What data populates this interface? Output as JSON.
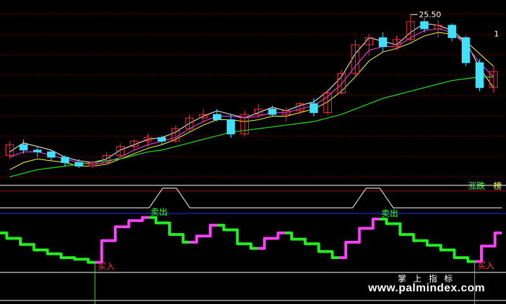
{
  "colors": {
    "background": "#000000",
    "up_candle": "#ff3030",
    "down_candle": "#40e0ff",
    "ma_short": "#ffffff",
    "ma_mid": "#ffff40",
    "ma_long": "#ff40ff",
    "ma_longest": "#20e020",
    "grid": "#7a1010",
    "osc_up": "#ff40ff",
    "osc_down": "#20f020",
    "osc_signal": "#ffffff",
    "osc_level_mid": "#2030ff",
    "buy_text": "#ff3030",
    "sell_text": "#30ff30"
  },
  "top_panel": {
    "high_label": "25.50",
    "ma_label": "1"
  },
  "tabs": {
    "tab1": "涨跌",
    "tab2": "榜"
  },
  "signals": {
    "buy": "买入",
    "sell": "卖出"
  },
  "watermark": {
    "line1": "掌上指标",
    "line2": "www.palmindex.com"
  },
  "chart_data": [
    {
      "type": "candlestick",
      "title": "",
      "series": [
        {
          "name": "",
          "values": [
            17.8,
            18.3,
            18.1,
            17.9,
            17.5,
            17.3,
            17.2,
            17.4,
            17.9,
            18.2,
            18.5,
            18.6,
            18.9,
            19.4,
            19.8,
            20.1,
            19.9,
            19.7,
            20.0,
            20.3,
            20.1,
            20.4,
            20.6,
            21.2,
            22.0,
            23.3,
            24.2,
            24.0,
            23.8,
            24.5,
            25.0,
            24.9,
            24.6,
            24.0,
            22.5,
            21.4
          ]
        },
        {
          "name": "",
          "values": [
            16.8,
            17.2,
            17.4,
            17.3,
            17.2,
            17.0,
            17.0,
            17.1,
            17.4,
            17.7,
            18.0,
            18.2,
            18.5,
            18.9,
            19.3,
            19.6,
            19.6,
            19.5,
            19.6,
            19.8,
            19.8,
            20.0,
            20.2,
            20.6,
            21.2,
            22.0,
            22.9,
            23.4,
            23.6,
            23.9,
            24.3,
            24.5,
            24.4,
            24.0,
            23.3,
            22.6
          ]
        },
        {
          "name": "",
          "values": [
            17.5,
            17.8,
            17.8,
            17.6,
            17.4,
            17.2,
            17.1,
            17.2,
            17.5,
            17.9,
            18.2,
            18.4,
            18.6,
            19.1,
            19.5,
            19.8,
            19.8,
            19.7,
            19.8,
            20.0,
            20.0,
            20.2,
            20.4,
            20.9,
            21.6,
            22.6,
            23.5,
            23.7,
            23.7,
            24.2,
            24.6,
            24.7,
            24.5,
            23.8,
            22.8,
            22.0
          ]
        },
        {
          "name": "",
          "values": [
            16.4,
            16.6,
            16.8,
            16.9,
            17.0,
            17.1,
            17.2,
            17.3,
            17.4,
            17.6,
            17.8,
            17.9,
            18.1,
            18.3,
            18.5,
            18.7,
            18.9,
            19.0,
            19.1,
            19.2,
            19.3,
            19.4,
            19.5,
            19.7,
            19.9,
            20.2,
            20.5,
            20.8,
            21.0,
            21.2,
            21.4,
            21.6,
            21.8,
            21.9,
            22.0,
            22.0
          ]
        }
      ],
      "ohlc": [
        [
          17.6,
          18.4,
          17.4,
          18.2
        ],
        [
          18.2,
          18.5,
          17.7,
          17.9
        ],
        [
          17.9,
          18.1,
          17.5,
          17.8
        ],
        [
          17.8,
          17.9,
          17.3,
          17.5
        ],
        [
          17.5,
          17.6,
          17.0,
          17.2
        ],
        [
          17.2,
          17.4,
          16.9,
          17.0
        ],
        [
          17.0,
          17.3,
          16.9,
          17.2
        ],
        [
          17.2,
          17.8,
          17.1,
          17.6
        ],
        [
          17.6,
          18.3,
          17.5,
          18.1
        ],
        [
          18.1,
          18.5,
          17.9,
          18.4
        ],
        [
          18.4,
          18.8,
          18.1,
          18.6
        ],
        [
          18.6,
          18.7,
          18.2,
          18.4
        ],
        [
          18.4,
          19.3,
          18.3,
          19.1
        ],
        [
          19.1,
          19.9,
          18.9,
          19.7
        ],
        [
          19.7,
          20.2,
          19.4,
          19.9
        ],
        [
          19.9,
          20.2,
          19.5,
          19.6
        ],
        [
          19.6,
          19.9,
          18.6,
          18.8
        ],
        [
          18.8,
          20.1,
          18.7,
          19.9
        ],
        [
          19.9,
          20.5,
          19.7,
          20.2
        ],
        [
          20.2,
          20.4,
          19.8,
          19.9
        ],
        [
          19.9,
          20.3,
          19.5,
          20.1
        ],
        [
          20.1,
          20.6,
          19.9,
          20.5
        ],
        [
          20.5,
          20.8,
          19.8,
          20.0
        ],
        [
          20.0,
          21.3,
          19.9,
          21.1
        ],
        [
          21.1,
          22.4,
          21.0,
          22.2
        ],
        [
          22.2,
          24.1,
          22.0,
          23.8
        ],
        [
          23.8,
          24.4,
          23.2,
          24.2
        ],
        [
          24.2,
          24.5,
          23.4,
          23.7
        ],
        [
          23.7,
          24.3,
          23.5,
          24.1
        ],
        [
          24.1,
          25.5,
          24.0,
          25.1
        ],
        [
          25.1,
          25.3,
          24.5,
          24.7
        ],
        [
          24.7,
          25.2,
          24.2,
          24.9
        ],
        [
          24.9,
          25.0,
          24.0,
          24.2
        ],
        [
          24.2,
          24.3,
          22.6,
          22.8
        ],
        [
          22.8,
          23.0,
          21.2,
          21.4
        ],
        [
          21.4,
          22.6,
          21.1,
          22.3
        ]
      ],
      "ylim": [
        16.0,
        26.0
      ]
    },
    {
      "type": "line",
      "title": "",
      "series": [
        {
          "name": "",
          "values": [
            62,
            55,
            47,
            40,
            35,
            30,
            28,
            24,
            52,
            70,
            78,
            82,
            75,
            60,
            50,
            58,
            72,
            66,
            48,
            42,
            55,
            62,
            54,
            48,
            38,
            30,
            50,
            68,
            80,
            74,
            60,
            52,
            46,
            40,
            30,
            25,
            45,
            62
          ]
        },
        {
          "name": "",
          "values": [
            0,
            0,
            0,
            0,
            0,
            0,
            0,
            0,
            0,
            0,
            0,
            0,
            100,
            100,
            0,
            0,
            0,
            0,
            0,
            0,
            0,
            0,
            0,
            0,
            0,
            0,
            0,
            100,
            100,
            0,
            0,
            0,
            0,
            0,
            0,
            0,
            0,
            0
          ]
        }
      ],
      "levels": [
        100,
        80,
        20,
        0
      ],
      "ylim": [
        0,
        100
      ]
    }
  ]
}
